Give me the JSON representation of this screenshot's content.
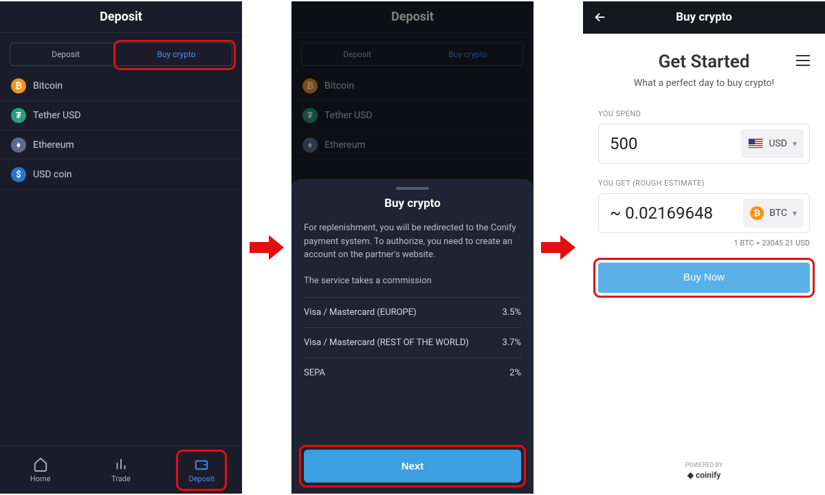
{
  "panel1": {
    "title": "Deposit",
    "tabs": {
      "deposit": "Deposit",
      "buy": "Buy crypto"
    },
    "coins": [
      {
        "sym": "₿",
        "name": "Bitcoin",
        "cls": "btc-bg"
      },
      {
        "sym": "₮",
        "name": "Tether USD",
        "cls": "usdt-bg"
      },
      {
        "sym": "Ξ",
        "name": "Ethereum",
        "cls": "eth-bg"
      },
      {
        "sym": "$",
        "name": "USD coin",
        "cls": "usdc-bg"
      }
    ],
    "nav": {
      "home": "Home",
      "trade": "Trade",
      "deposit": "Deposit"
    }
  },
  "panel2": {
    "title": "Deposit",
    "tabs": {
      "deposit": "Deposit",
      "buy": "Buy crypto"
    },
    "sheet": {
      "title": "Buy crypto",
      "body": "For replenishment, you will be redirected to the Conify payment system. To authorize, you need to create an account on the partner's website.",
      "note": "The service takes a commission",
      "fees": [
        {
          "label": "Visa / Mastercard (EUROPE)",
          "value": "3.5%"
        },
        {
          "label": "Visa / Mastercard (REST OF THE WORLD)",
          "value": "3.7%"
        },
        {
          "label": "SEPA",
          "value": "2%"
        }
      ],
      "next": "Next"
    }
  },
  "panel3": {
    "title": "Buy crypto",
    "getStarted": "Get Started",
    "subtitle": "What a perfect day to buy crypto!",
    "spendLabel": "YOU SPEND",
    "spendValue": "500",
    "spendCurr": "USD",
    "getLabel": "YOU GET (ROUGH ESTIMATE)",
    "getValue": "~ 0.02169648",
    "getCurr": "BTC",
    "rate": "1 BTC = 23045.21 USD",
    "buy": "Buy Now",
    "powered": "POWERED BY",
    "brand": "coinify"
  }
}
